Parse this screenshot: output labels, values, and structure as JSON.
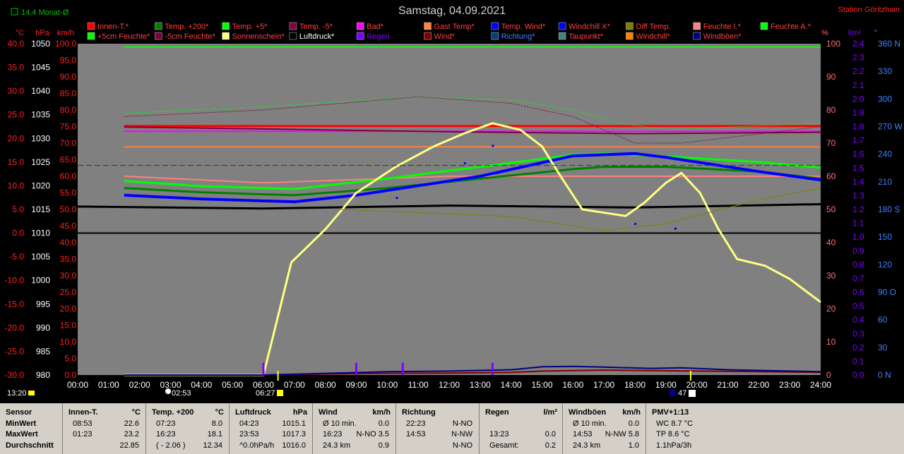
{
  "header": {
    "title": "Samstag, 04.09.2021",
    "station": "Station Göritzhain",
    "avg_label": "14.4 Monat-Ø"
  },
  "colors": {
    "background": "#000000",
    "plot_bg": "#808080",
    "accent_red": "#ff2020"
  },
  "legend": {
    "row1": [
      {
        "label": "Innen-T.*",
        "color": "#ff0000",
        "text_color": "#ff4040"
      },
      {
        "label": "Temp. +200*",
        "color": "#008000",
        "text_color": "#ff4040"
      },
      {
        "label": "Temp. +5*",
        "color": "#00ff00",
        "text_color": "#ff4040"
      },
      {
        "label": "Temp. -5*",
        "color": "#800040",
        "text_color": "#ff4040"
      },
      {
        "label": "Bad*",
        "color": "#ff00ff",
        "text_color": "#ff4040"
      },
      {
        "label": "Gast Temp*",
        "color": "#ff8040",
        "text_color": "#ff4040"
      },
      {
        "label": "Temp. Wind*",
        "color": "#0000ff",
        "text_color": "#ff4040"
      },
      {
        "label": "Windchill X*",
        "color": "#0000ff",
        "text_color": "#ff4040"
      },
      {
        "label": "Diff Temp.",
        "color": "#808000",
        "text_color": "#ff4040"
      },
      {
        "label": "Feuchte I.*",
        "color": "#ff8080",
        "text_color": "#ff4040"
      },
      {
        "label": "Feuchte A.*",
        "color": "#00ff00",
        "text_color": "#ff4040"
      }
    ],
    "row2": [
      {
        "label": "+5cm Feuchte*",
        "color": "#00ff00",
        "text_color": "#ff4040"
      },
      {
        "label": "-5cm Feuchte*",
        "color": "#800040",
        "text_color": "#ff4040"
      },
      {
        "label": "Sonnenschein*",
        "color": "#ffff80",
        "text_color": "#ff4040"
      },
      {
        "label": "Luftdruck*",
        "color": "#000000",
        "text_color": "#ffffff"
      },
      {
        "label": "Regen",
        "color": "#8000ff",
        "text_color": "#8000ff"
      },
      {
        "label": "Wind*",
        "color": "#800000",
        "text_color": "#ff4040"
      },
      {
        "label": "Richtung*",
        "color": "#004080",
        "text_color": "#4080ff"
      },
      {
        "label": "Taupunkt*",
        "color": "#408080",
        "text_color": "#ff4040"
      },
      {
        "label": "Windchill*",
        "color": "#ff8000",
        "text_color": "#ff4040"
      },
      {
        "label": "Windböen*",
        "color": "#000080",
        "text_color": "#ff4040"
      }
    ]
  },
  "markers": {
    "left_time": "13:20",
    "sunrise": "02:53",
    "sunrise2": "06:27",
    "sunset_small": "47"
  },
  "chart_data": {
    "type": "line",
    "x_unit": "hour",
    "xlim": [
      0,
      24
    ],
    "x_ticks": [
      "00:00",
      "01:00",
      "02:00",
      "03:00",
      "04:00",
      "05:00",
      "06:00",
      "07:00",
      "08:00",
      "09:00",
      "10:00",
      "11:00",
      "12:00",
      "13:00",
      "14:00",
      "15:00",
      "16:00",
      "17:00",
      "18:00",
      "19:00",
      "20:00",
      "21:00",
      "22:00",
      "23:00",
      "24:00"
    ],
    "axes": {
      "temp_c": {
        "label": "°C",
        "ylim": [
          -30,
          40
        ],
        "ticks": [
          "40.0",
          "35.0",
          "30.0",
          "25.0",
          "20.0",
          "15.0",
          "10.0",
          "5.0",
          "0.0",
          "-5.0",
          "-10.0",
          "-15.0",
          "-20.0",
          "-25.0",
          "-30.0"
        ]
      },
      "pressure_hpa": {
        "label": "hPa",
        "ylim": [
          980,
          1050
        ],
        "ticks": [
          "1050",
          "1045",
          "1040",
          "1035",
          "1030",
          "1025",
          "1020",
          "1015",
          "1010",
          "1005",
          "1000",
          "995",
          "990",
          "985",
          "980"
        ]
      },
      "wind_kmh": {
        "label": "km/h",
        "ylim": [
          0,
          100
        ],
        "ticks": [
          "100.0",
          "95.0",
          "90.0",
          "85.0",
          "80.0",
          "75.0",
          "70.0",
          "65.0",
          "60.0",
          "55.0",
          "50.0",
          "45.0",
          "40.0",
          "35.0",
          "30.0",
          "25.0",
          "20.0",
          "15.0",
          "10.0",
          "5.0",
          "0.0"
        ]
      },
      "humidity_pct": {
        "label": "%",
        "ylim": [
          0,
          100
        ],
        "ticks": [
          "100",
          "90",
          "80",
          "70",
          "60",
          "50",
          "40",
          "30",
          "20",
          "10",
          "0"
        ]
      },
      "rain_lm2": {
        "label": "l/m²",
        "ylim": [
          0,
          2.5
        ],
        "ticks": [
          "2.4",
          "2.3",
          "2.2",
          "2.1",
          "2.0",
          "1.9",
          "1.8",
          "1.7",
          "1.6",
          "1.5",
          "1.4",
          "1.3",
          "1.2",
          "1.1",
          "1.0",
          "0.9",
          "0.8",
          "0.7",
          "0.6",
          "0.5",
          "0.4",
          "0.3",
          "0.2",
          "0.1",
          "0.0"
        ]
      },
      "direction_deg": {
        "label": "°",
        "ylim": [
          0,
          360
        ],
        "ticks": [
          "360 N",
          "330",
          "300",
          "270 W",
          "240",
          "210",
          "180 S",
          "150",
          "120",
          "90 O",
          "60",
          "30",
          "0 N"
        ]
      }
    },
    "series": [
      {
        "name": "Innen-T.*",
        "axis": "temp_c",
        "color": "#ff0000",
        "width": 3,
        "x": [
          1.5,
          24
        ],
        "y": [
          22.6,
          22.6
        ]
      },
      {
        "name": "Bad*",
        "axis": "temp_c",
        "color": "#ff00ff",
        "width": 2,
        "x": [
          1.5,
          24
        ],
        "y": [
          21.5,
          21.5
        ]
      },
      {
        "name": "Gast Temp*",
        "axis": "temp_c",
        "color": "#ff8040",
        "width": 2,
        "x": [
          1.5,
          24
        ],
        "y": [
          18.2,
          18.2
        ]
      },
      {
        "name": "Temp. -5*",
        "axis": "temp_c",
        "color": "#800040",
        "width": 2,
        "x": [
          1.5,
          6,
          12,
          18,
          24
        ],
        "y": [
          22.4,
          22.0,
          21.4,
          21.0,
          21.3
        ]
      },
      {
        "name": "Feuchte I.*",
        "axis": "humidity_pct",
        "color": "#ff8080",
        "width": 2,
        "x": [
          1.5,
          6,
          12,
          18,
          24
        ],
        "y": [
          60,
          58,
          60,
          60,
          60
        ]
      },
      {
        "name": "Temp. +200*",
        "axis": "temp_c",
        "color": "#008000",
        "width": 3,
        "x": [
          1.5,
          4,
          7,
          10,
          13,
          16,
          17,
          19,
          22,
          24
        ],
        "y": [
          9.5,
          8.6,
          8.0,
          9.5,
          11.5,
          13.5,
          14.0,
          14.0,
          13.0,
          11.5
        ]
      },
      {
        "name": "Temp. +5*",
        "axis": "temp_c",
        "color": "#00ff00",
        "width": 3,
        "x": [
          1.5,
          4,
          7,
          10,
          13,
          16,
          17,
          19,
          22,
          24
        ],
        "y": [
          11.0,
          9.9,
          9.3,
          11.5,
          14.0,
          16.5,
          16.8,
          16.2,
          15.0,
          13.8
        ]
      },
      {
        "name": "Temp. Wind*",
        "axis": "temp_c",
        "color": "#0000ff",
        "width": 4,
        "x": [
          1.5,
          4,
          7,
          9,
          13,
          16,
          18,
          19,
          22,
          24
        ],
        "y": [
          8.0,
          7.2,
          6.6,
          8.0,
          12.0,
          16.3,
          16.8,
          16.0,
          13.0,
          11.2
        ]
      },
      {
        "name": "Luftdruck*",
        "axis": "pressure_hpa",
        "color": "#000000",
        "width": 3,
        "x": [
          0,
          6,
          12,
          18,
          24
        ],
        "y": [
          1015.6,
          1015.2,
          1015.8,
          1015.4,
          1016.1
        ]
      },
      {
        "name": "Sonnenschein*",
        "axis": "wind_kmh",
        "color": "#ffff80",
        "width": 3,
        "x": [
          1.5,
          6,
          6.9,
          8,
          9,
          10.3,
          11.5,
          12.5,
          13.4,
          14.3,
          15.0,
          15.6,
          16.3,
          17.0,
          17.7,
          18.3,
          19.0,
          19.5,
          20.1,
          20.7,
          21.3,
          22.2,
          23.0,
          24.0
        ],
        "y": [
          0,
          0,
          34,
          44,
          55,
          63,
          69,
          73,
          76,
          74,
          69,
          60,
          50,
          49,
          48,
          52,
          58,
          61,
          55,
          44,
          35,
          33,
          29,
          22
        ]
      },
      {
        "name": "Feuchte A.*",
        "axis": "humidity_pct",
        "color": "#00ff00",
        "width": 1,
        "dash": "2,2",
        "x": [
          1.5,
          6,
          11,
          14,
          16,
          17.5,
          19,
          24
        ],
        "y": [
          79,
          81,
          84,
          83,
          80,
          76,
          74,
          76
        ]
      },
      {
        "name": "-5cm Feuchte*",
        "axis": "humidity_pct",
        "color": "#800040",
        "width": 1,
        "dash": "2,2",
        "x": [
          1.5,
          6,
          11,
          14,
          16,
          18,
          19.5,
          24
        ],
        "y": [
          78,
          80,
          84,
          82,
          78,
          70,
          70,
          75
        ]
      },
      {
        "name": "Taupunkt*",
        "axis": "temp_c",
        "color": "#006000",
        "width": 1,
        "dash": "8,4",
        "x": [
          0,
          24
        ],
        "y": [
          14.3,
          14.3
        ]
      },
      {
        "name": "Diff Temp.",
        "axis": "temp_c",
        "color": "#808000",
        "width": 1,
        "x": [
          8.5,
          14,
          17,
          19,
          22,
          24
        ],
        "y": [
          5.0,
          3.5,
          0.5,
          2.0,
          7.0,
          9.5
        ]
      },
      {
        "name": "Wind*",
        "axis": "wind_kmh",
        "color": "#800000",
        "width": 2,
        "x": [
          1.5,
          6,
          8,
          10,
          12,
          14,
          15,
          17,
          19,
          21,
          24
        ],
        "y": [
          0,
          0,
          0.3,
          0.5,
          0.6,
          0.8,
          1.2,
          1.5,
          1.3,
          1.1,
          0.8
        ]
      },
      {
        "name": "Windböen*",
        "axis": "wind_kmh",
        "color": "#000080",
        "width": 2,
        "x": [
          1.5,
          6,
          8,
          10,
          12,
          14,
          15,
          16,
          17,
          18.5,
          19.5,
          21,
          24
        ],
        "y": [
          0,
          0,
          0.5,
          1.0,
          1.2,
          1.6,
          2.5,
          2.6,
          2.4,
          2.0,
          2.2,
          1.6,
          1.0
        ]
      },
      {
        "name": "Regen",
        "axis": "rain_lm2",
        "color": "#8000ff",
        "width": 2,
        "type": "bars",
        "x": [
          6.0,
          9.0,
          10.5,
          13.4
        ],
        "y": [
          0.05,
          0.05,
          0.05,
          0.05
        ]
      }
    ]
  },
  "stats": {
    "columns": [
      {
        "header": "Sensor",
        "unit": "",
        "rows": [
          "MinWert",
          "MaxWert",
          "Durchschnitt"
        ]
      },
      {
        "header": "Innen-T.",
        "unit": "°C",
        "rows": [
          [
            "08:53",
            "22.6"
          ],
          [
            "01:23",
            "23.2"
          ],
          [
            "",
            "22.85"
          ]
        ]
      },
      {
        "header": "Temp. +200",
        "unit": "°C",
        "rows": [
          [
            "07:23",
            "8.0"
          ],
          [
            "16:23",
            "18.1"
          ],
          [
            "( - 2.06 )",
            "12.34"
          ]
        ]
      },
      {
        "header": "Luftdruck",
        "unit": "hPa",
        "rows": [
          [
            "04:23",
            "1015.1"
          ],
          [
            "23:53",
            "1017.3"
          ],
          [
            "^0.0hPa/h",
            "1016.0"
          ]
        ]
      },
      {
        "header": "Wind",
        "unit": "km/h",
        "rows": [
          [
            "Ø 10 min.",
            "0.0"
          ],
          [
            "16:23",
            "N-NO 3.5"
          ],
          [
            "24.3 km",
            "0.9"
          ]
        ]
      },
      {
        "header": "Richtung",
        "unit": "",
        "rows": [
          [
            "22:23",
            "N-NO"
          ],
          [
            "14:53",
            "N-NW"
          ],
          [
            "",
            "N-NO"
          ]
        ]
      },
      {
        "header": "Regen",
        "unit": "l/m²",
        "rows": [
          [
            "",
            ""
          ],
          [
            "13:23",
            "0.0"
          ],
          [
            "Gesamt:",
            "0.2"
          ]
        ]
      },
      {
        "header": "Windböen",
        "unit": "km/h",
        "rows": [
          [
            "Ø 10 min.",
            "0.0"
          ],
          [
            "14:53",
            "N-NW 5.8"
          ],
          [
            "24.3 km",
            "1.0"
          ]
        ]
      },
      {
        "header": "PMV+1:13",
        "unit": "",
        "rows": [
          [
            "WC 8.7 °C",
            ""
          ],
          [
            "TP 8.6 °C",
            ""
          ],
          [
            "1.1hPa/3h",
            ""
          ]
        ]
      }
    ]
  }
}
